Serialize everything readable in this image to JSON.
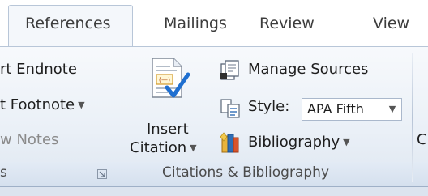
{
  "tabs": [
    {
      "label": "References",
      "active": true
    },
    {
      "label": "Mailings",
      "active": false
    },
    {
      "label": "Review",
      "active": false
    },
    {
      "label": "View",
      "active": false
    }
  ],
  "footnotes_group": {
    "insert_endnote": "rt Endnote",
    "next_footnote": "t Footnote",
    "show_notes": "w Notes",
    "label": "s"
  },
  "citations_group": {
    "insert_citation_line1": "Insert",
    "insert_citation_line2": "Citation",
    "manage_sources": "Manage Sources",
    "style_label": "Style:",
    "style_value": "APA Fifth",
    "bibliography": "Bibliography",
    "label": "Citations & Bibliography"
  },
  "next_group_partial": "C",
  "colors": {
    "ribbon_bg": "#eaf0f7",
    "tab_bg": "#ffffff",
    "accent_blue": "#2f6db5",
    "disabled_text": "#8a8a8a"
  }
}
